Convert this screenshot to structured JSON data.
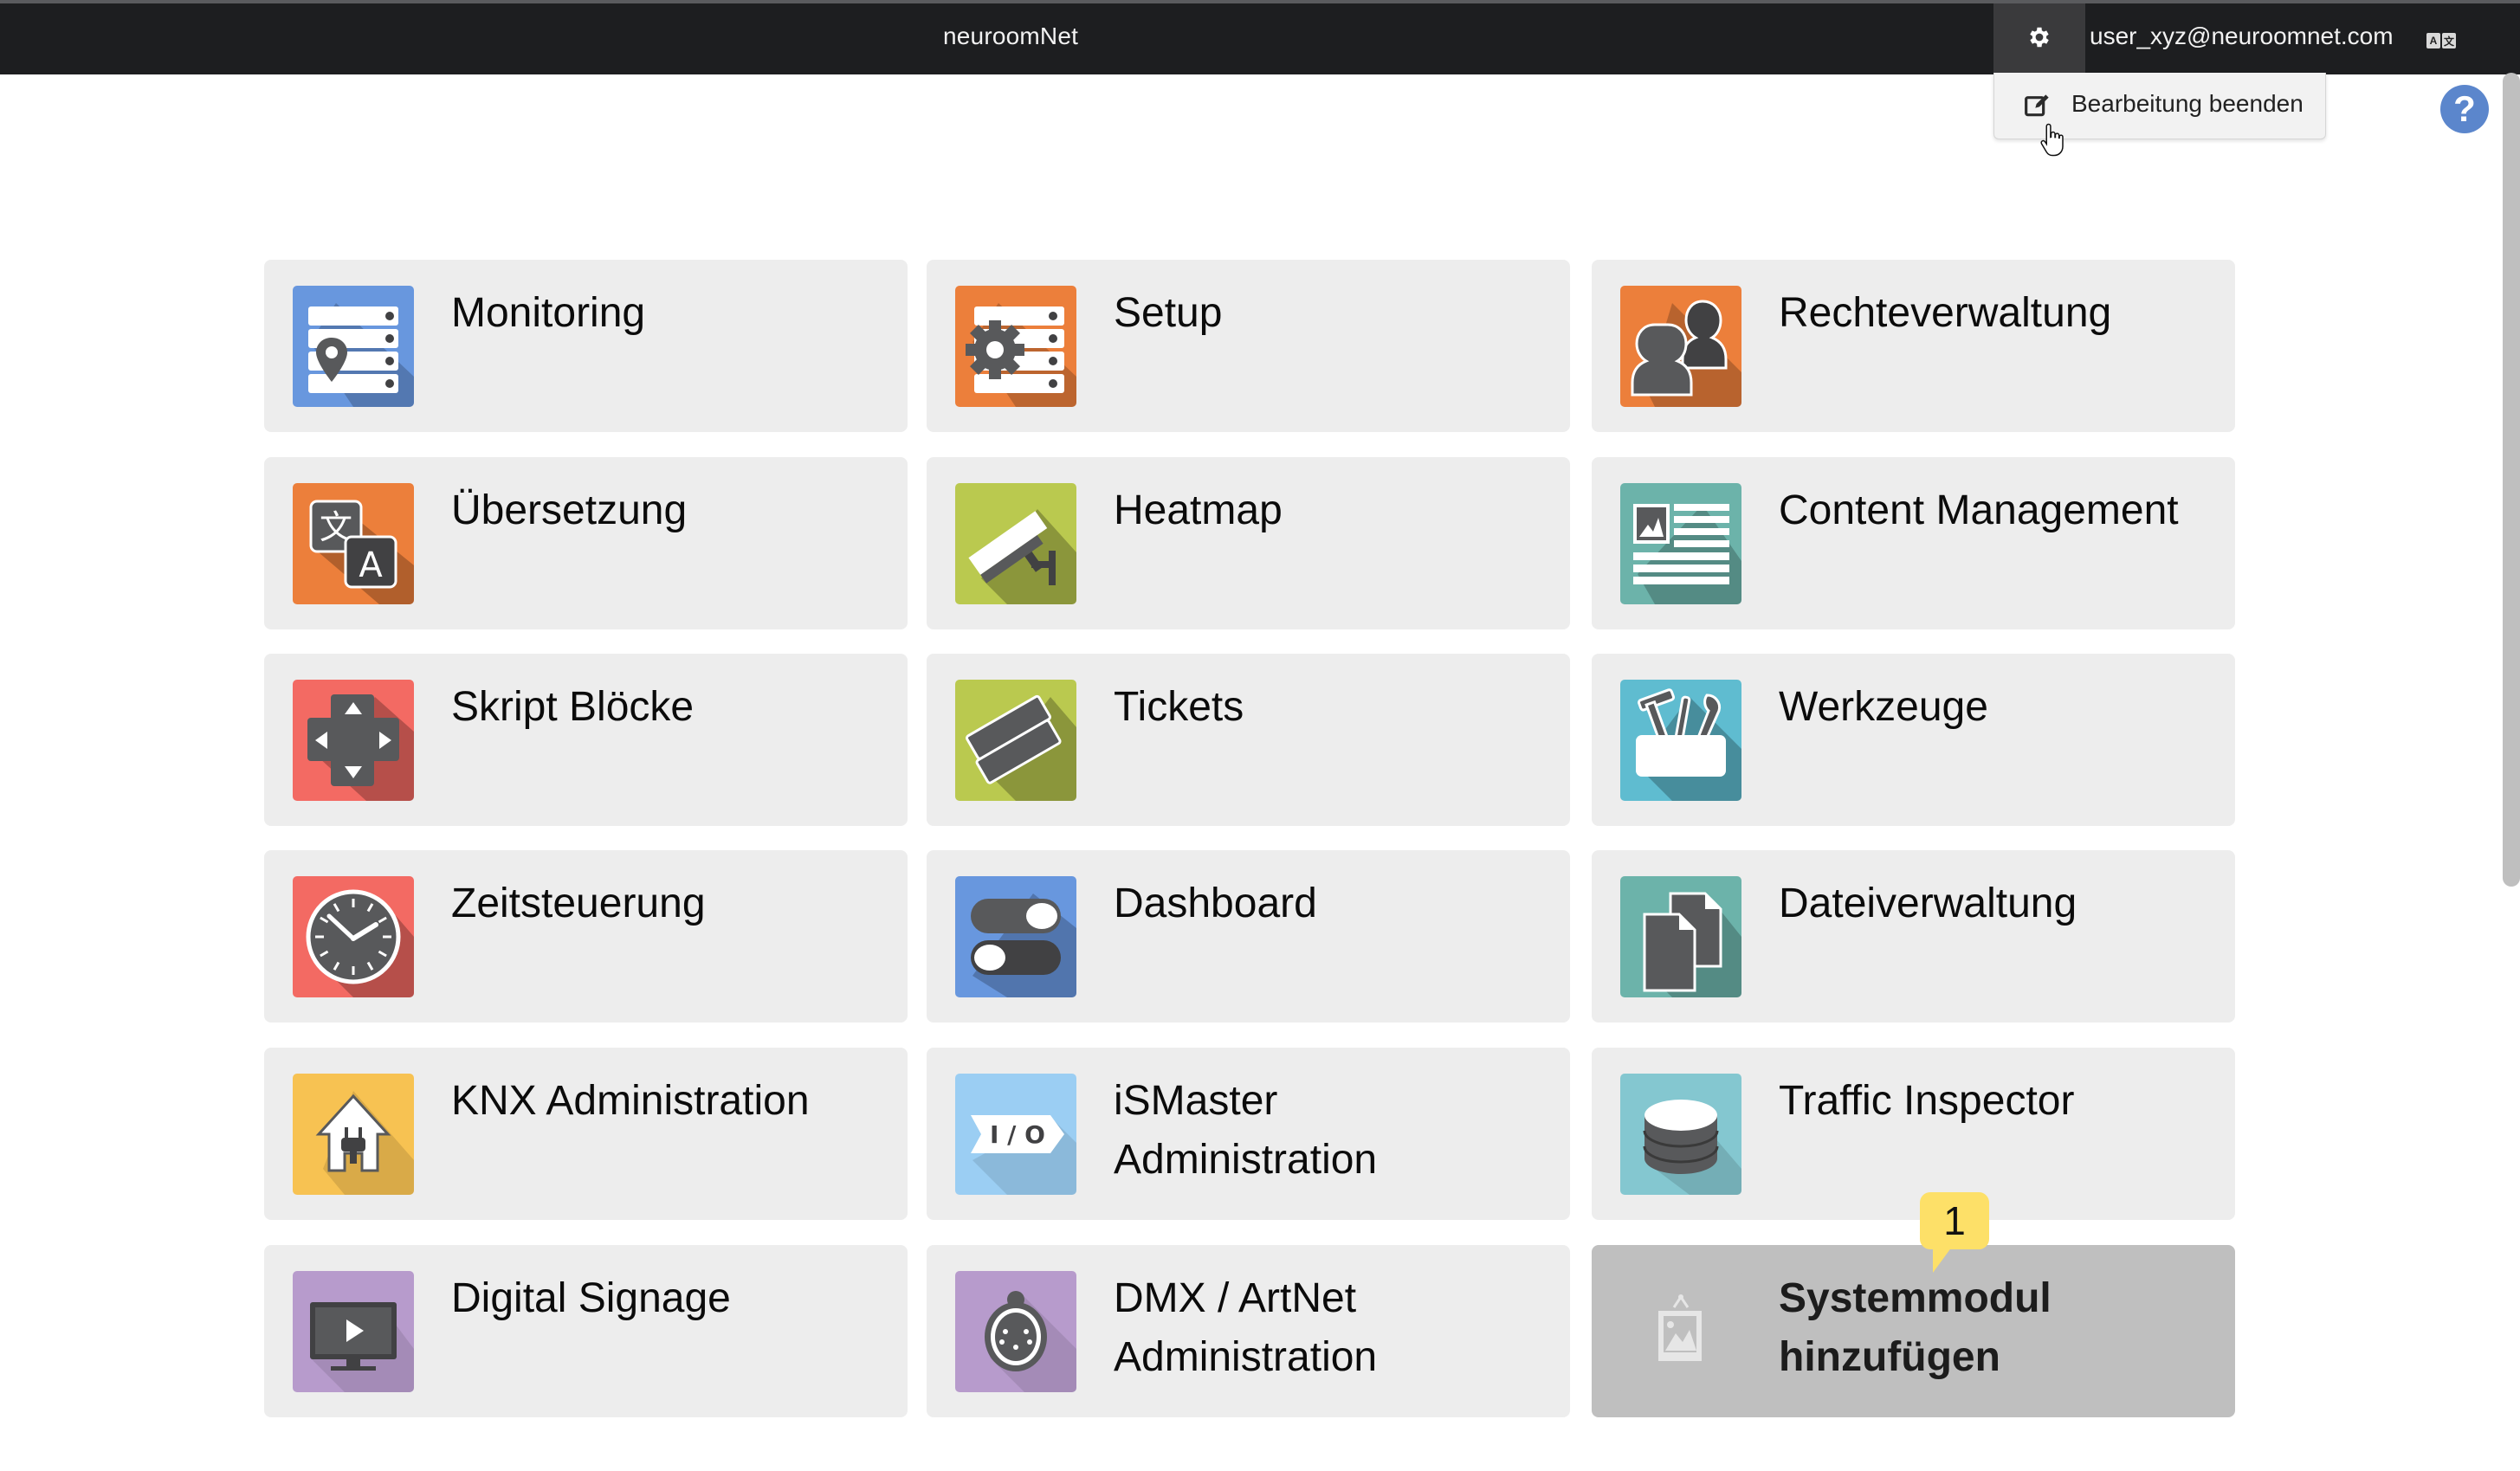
{
  "navbar": {
    "title": "neuroomNet",
    "user_email": "user_xyz@neuroomnet.com",
    "settings_icon": "gear-icon",
    "language_icon": "translate-icon",
    "language_glyphs": [
      "A",
      "文"
    ]
  },
  "dropdown": {
    "items": [
      {
        "label": "Bearbeitung beenden",
        "icon": "edit-icon"
      }
    ]
  },
  "help": {
    "glyph": "?",
    "icon": "help-icon"
  },
  "tiles": [
    {
      "label": "Monitoring",
      "icon": "server-location-icon",
      "color": "#6897de"
    },
    {
      "label": "Setup",
      "icon": "server-gear-icon",
      "color": "#ec7f3b"
    },
    {
      "label": "Rechteverwaltung",
      "icon": "users-icon",
      "color": "#ec7f3b"
    },
    {
      "label": "Übersetzung",
      "icon": "translate-icon",
      "color": "#ec7f3b"
    },
    {
      "label": "Heatmap",
      "icon": "security-camera-icon",
      "color": "#bac94f"
    },
    {
      "label": "Content Management",
      "icon": "article-icon",
      "color": "#6cb3aa"
    },
    {
      "label": "Skript Blöcke",
      "icon": "dpad-icon",
      "color": "#f36a63"
    },
    {
      "label": "Tickets",
      "icon": "tickets-icon",
      "color": "#bac94f"
    },
    {
      "label": "Werkzeuge",
      "icon": "toolbox-icon",
      "color": "#5fbcd0"
    },
    {
      "label": "Zeitsteuerung",
      "icon": "clock-icon",
      "color": "#f36a63"
    },
    {
      "label": "Dashboard",
      "icon": "toggles-icon",
      "color": "#6897de"
    },
    {
      "label": "Dateiverwaltung",
      "icon": "files-icon",
      "color": "#6cb3aa"
    },
    {
      "label": "KNX Administration",
      "icon": "house-plug-icon",
      "color": "#f7c252"
    },
    {
      "label": "iSMaster Administration",
      "icon": "io-icon",
      "color": "#9bcef3"
    },
    {
      "label": "Traffic Inspector",
      "icon": "database-icon",
      "color": "#84c7d0"
    },
    {
      "label": "Digital Signage",
      "icon": "monitor-play-icon",
      "color": "#b79bcc"
    },
    {
      "label": "DMX / ArtNet Administration",
      "icon": "dmx-connector-icon",
      "color": "#b79bcc"
    },
    {
      "label": "Systemmodul hinzufügen",
      "icon": "image-placeholder-icon",
      "color": "#bfbfbf"
    }
  ],
  "notification_badge": {
    "count": "1",
    "color": "#fde068"
  }
}
